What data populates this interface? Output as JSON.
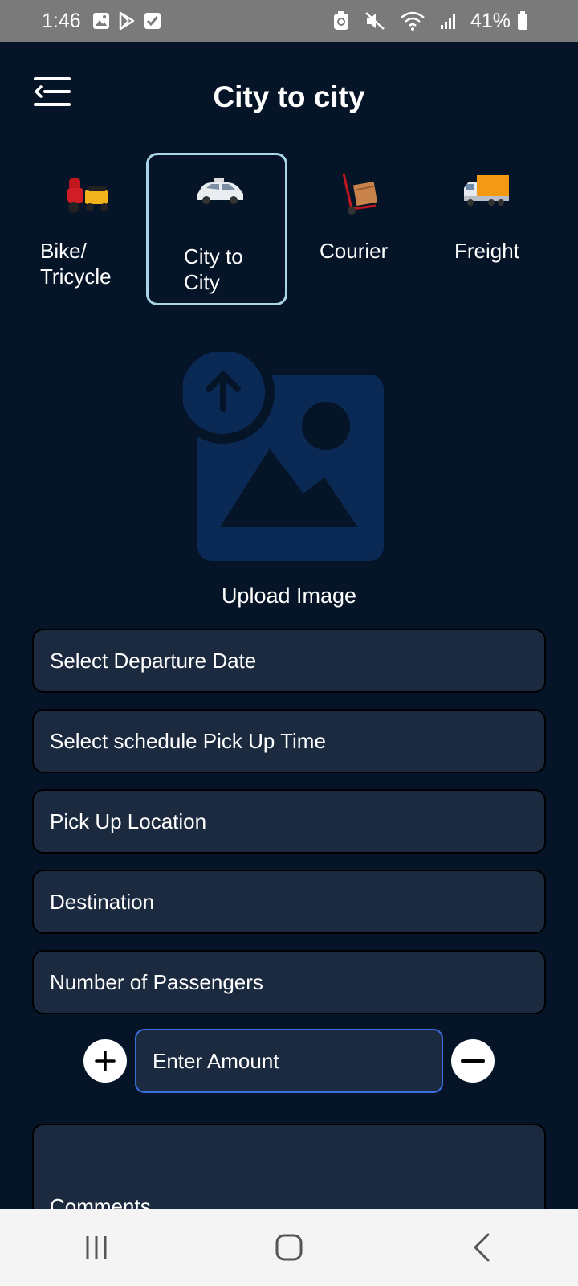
{
  "status_bar": {
    "time": "1:46",
    "battery": "41%"
  },
  "header": {
    "title": "City to city"
  },
  "categories": [
    {
      "label_line1": "Bike/",
      "label_line2": "Tricycle",
      "icon": "bike-tricycle-icon",
      "selected": false
    },
    {
      "label_line1": "City to",
      "label_line2": "City",
      "icon": "car-icon",
      "selected": true
    },
    {
      "label_line1": "Courier",
      "label_line2": "",
      "icon": "courier-cart-icon",
      "selected": false
    },
    {
      "label_line1": "Freight",
      "label_line2": "",
      "icon": "truck-icon",
      "selected": false
    }
  ],
  "upload": {
    "label": "Upload Image"
  },
  "fields": {
    "departure_date": "Select Departure Date",
    "pickup_time": "Select schedule Pick Up Time",
    "pickup_location": "Pick Up Location",
    "destination": "Destination",
    "passengers": "Number of Passengers",
    "amount_placeholder": "Enter Amount",
    "comments": "Comments"
  },
  "colors": {
    "background": "#061427",
    "field": "#1b2a3e",
    "selected_border": "#a9d4e6",
    "amount_border": "#3b6fe0",
    "upload_icon": "#0a2a55"
  }
}
